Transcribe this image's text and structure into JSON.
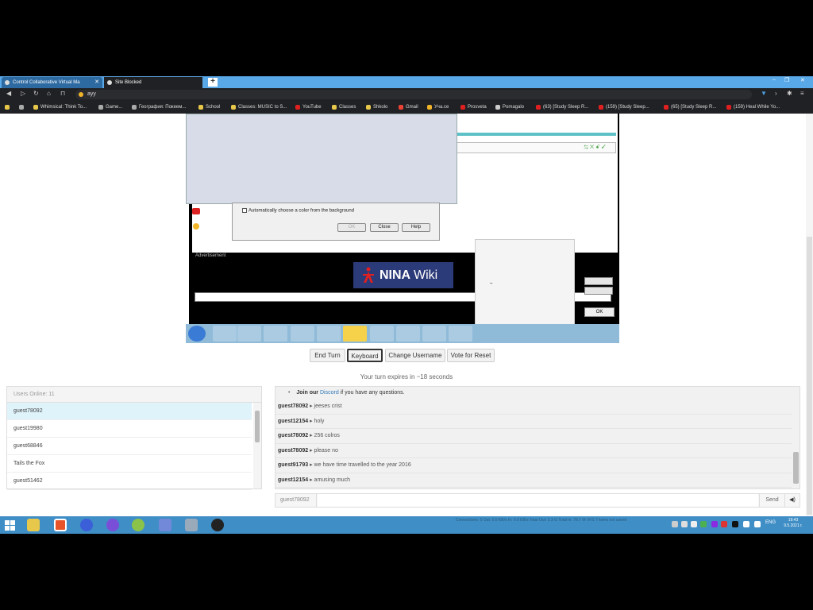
{
  "browser": {
    "tabs": [
      {
        "title": "Control Collaborative Virtual Ma",
        "close": "✕"
      },
      {
        "title": "Site Blocked"
      }
    ],
    "new_tab": "+",
    "window_controls": {
      "minimize": "–",
      "restore": "❐",
      "close": "✕"
    },
    "address": "ayy",
    "bookmarks": [
      {
        "label": "Whimsical: Think To...",
        "color": "#e0c020"
      },
      {
        "label": "Game...",
        "color": "#aaaaaa"
      },
      {
        "label": "География: Покеем...",
        "color": "#aaaaaa"
      },
      {
        "label": "School",
        "color": "#e8c84a"
      },
      {
        "label": "Classes: MUSIC to S...",
        "color": "#e8c84a"
      },
      {
        "label": "YouTube",
        "color": "#e02020"
      },
      {
        "label": "Classes",
        "color": "#e8c84a"
      },
      {
        "label": "Shkolo",
        "color": "#e8c84a"
      },
      {
        "label": "Gmail",
        "color": "#ea4335"
      },
      {
        "label": "Уча.се",
        "color": "#f0b429"
      },
      {
        "label": "Prosveta",
        "color": "#e02020"
      },
      {
        "label": "Pomagalo",
        "color": "#cccccc"
      },
      {
        "label": "(63) [Study Sleep R...",
        "color": "#e02020"
      },
      {
        "label": "(159) [Study Sleep...",
        "color": "#e02020"
      },
      {
        "label": "(65) [Study Sleep R...",
        "color": "#e02020"
      },
      {
        "label": "(159) Heal While Yo...",
        "color": "#e02020"
      }
    ]
  },
  "vm": {
    "checkbox_label": "Automatically choose a color from the background",
    "dialog_buttons": [
      "OK",
      "Close",
      "Help"
    ],
    "advert": "Advertisement",
    "nina_brand": "NINA",
    "nina_wiki": "Wiki",
    "ok_button": "OK",
    "small_dash": "–",
    "addr_icon": "⇆ ✕ ꗃ ✓"
  },
  "controls": {
    "end_turn": "End Turn",
    "keyboard": "Keyboard",
    "change_username": "Change Username",
    "vote_reset": "Vote for Reset"
  },
  "turn_text": "Your turn expires in ~18 seconds",
  "users": {
    "header": "Users Online: 11",
    "list": [
      "guest78092",
      "guest19980",
      "guest68846",
      "Tails the Fox",
      "guest51462"
    ]
  },
  "chat": {
    "notice_prefix": "Join our",
    "notice_link": "Discord",
    "notice_suffix": "if you have any questions.",
    "messages": [
      {
        "user": "guest78092",
        "text": "jeeses crist"
      },
      {
        "user": "guest12154",
        "text": "holy"
      },
      {
        "user": "guest78092",
        "text": "256 colros"
      },
      {
        "user": "guest78092",
        "text": "please no"
      },
      {
        "user": "guest91793",
        "text": "we have time travelled to the year 2016"
      },
      {
        "user": "guest12154",
        "text": "amusing much"
      }
    ],
    "username": "guest78092",
    "send": "Send",
    "sound_icon": "◀)"
  },
  "taskbar": {
    "status": "Connections: 0    Out: 0.0 KB/s    In: 0.0 KB/s    Total Out: 3.3 G    Total In: 79.7 M    VFS    7 items    not saved",
    "lang": "ENG",
    "time": "19:43",
    "date": "9.5.2021 г."
  }
}
